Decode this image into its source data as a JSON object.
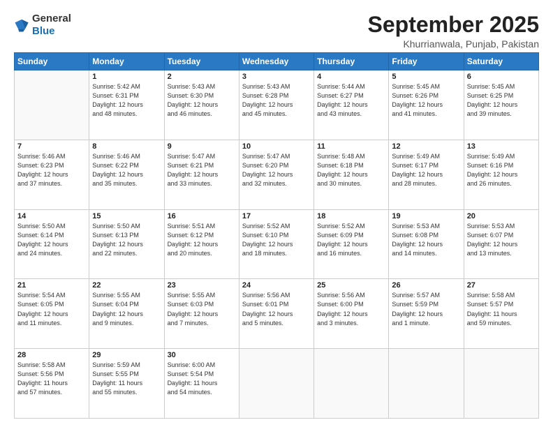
{
  "logo": {
    "general": "General",
    "blue": "Blue"
  },
  "header": {
    "month": "September 2025",
    "location": "Khurrianwala, Punjab, Pakistan"
  },
  "weekdays": [
    "Sunday",
    "Monday",
    "Tuesday",
    "Wednesday",
    "Thursday",
    "Friday",
    "Saturday"
  ],
  "weeks": [
    [
      {
        "day": "",
        "info": ""
      },
      {
        "day": "1",
        "info": "Sunrise: 5:42 AM\nSunset: 6:31 PM\nDaylight: 12 hours\nand 48 minutes."
      },
      {
        "day": "2",
        "info": "Sunrise: 5:43 AM\nSunset: 6:30 PM\nDaylight: 12 hours\nand 46 minutes."
      },
      {
        "day": "3",
        "info": "Sunrise: 5:43 AM\nSunset: 6:28 PM\nDaylight: 12 hours\nand 45 minutes."
      },
      {
        "day": "4",
        "info": "Sunrise: 5:44 AM\nSunset: 6:27 PM\nDaylight: 12 hours\nand 43 minutes."
      },
      {
        "day": "5",
        "info": "Sunrise: 5:45 AM\nSunset: 6:26 PM\nDaylight: 12 hours\nand 41 minutes."
      },
      {
        "day": "6",
        "info": "Sunrise: 5:45 AM\nSunset: 6:25 PM\nDaylight: 12 hours\nand 39 minutes."
      }
    ],
    [
      {
        "day": "7",
        "info": "Sunrise: 5:46 AM\nSunset: 6:23 PM\nDaylight: 12 hours\nand 37 minutes."
      },
      {
        "day": "8",
        "info": "Sunrise: 5:46 AM\nSunset: 6:22 PM\nDaylight: 12 hours\nand 35 minutes."
      },
      {
        "day": "9",
        "info": "Sunrise: 5:47 AM\nSunset: 6:21 PM\nDaylight: 12 hours\nand 33 minutes."
      },
      {
        "day": "10",
        "info": "Sunrise: 5:47 AM\nSunset: 6:20 PM\nDaylight: 12 hours\nand 32 minutes."
      },
      {
        "day": "11",
        "info": "Sunrise: 5:48 AM\nSunset: 6:18 PM\nDaylight: 12 hours\nand 30 minutes."
      },
      {
        "day": "12",
        "info": "Sunrise: 5:49 AM\nSunset: 6:17 PM\nDaylight: 12 hours\nand 28 minutes."
      },
      {
        "day": "13",
        "info": "Sunrise: 5:49 AM\nSunset: 6:16 PM\nDaylight: 12 hours\nand 26 minutes."
      }
    ],
    [
      {
        "day": "14",
        "info": "Sunrise: 5:50 AM\nSunset: 6:14 PM\nDaylight: 12 hours\nand 24 minutes."
      },
      {
        "day": "15",
        "info": "Sunrise: 5:50 AM\nSunset: 6:13 PM\nDaylight: 12 hours\nand 22 minutes."
      },
      {
        "day": "16",
        "info": "Sunrise: 5:51 AM\nSunset: 6:12 PM\nDaylight: 12 hours\nand 20 minutes."
      },
      {
        "day": "17",
        "info": "Sunrise: 5:52 AM\nSunset: 6:10 PM\nDaylight: 12 hours\nand 18 minutes."
      },
      {
        "day": "18",
        "info": "Sunrise: 5:52 AM\nSunset: 6:09 PM\nDaylight: 12 hours\nand 16 minutes."
      },
      {
        "day": "19",
        "info": "Sunrise: 5:53 AM\nSunset: 6:08 PM\nDaylight: 12 hours\nand 14 minutes."
      },
      {
        "day": "20",
        "info": "Sunrise: 5:53 AM\nSunset: 6:07 PM\nDaylight: 12 hours\nand 13 minutes."
      }
    ],
    [
      {
        "day": "21",
        "info": "Sunrise: 5:54 AM\nSunset: 6:05 PM\nDaylight: 12 hours\nand 11 minutes."
      },
      {
        "day": "22",
        "info": "Sunrise: 5:55 AM\nSunset: 6:04 PM\nDaylight: 12 hours\nand 9 minutes."
      },
      {
        "day": "23",
        "info": "Sunrise: 5:55 AM\nSunset: 6:03 PM\nDaylight: 12 hours\nand 7 minutes."
      },
      {
        "day": "24",
        "info": "Sunrise: 5:56 AM\nSunset: 6:01 PM\nDaylight: 12 hours\nand 5 minutes."
      },
      {
        "day": "25",
        "info": "Sunrise: 5:56 AM\nSunset: 6:00 PM\nDaylight: 12 hours\nand 3 minutes."
      },
      {
        "day": "26",
        "info": "Sunrise: 5:57 AM\nSunset: 5:59 PM\nDaylight: 12 hours\nand 1 minute."
      },
      {
        "day": "27",
        "info": "Sunrise: 5:58 AM\nSunset: 5:57 PM\nDaylight: 11 hours\nand 59 minutes."
      }
    ],
    [
      {
        "day": "28",
        "info": "Sunrise: 5:58 AM\nSunset: 5:56 PM\nDaylight: 11 hours\nand 57 minutes."
      },
      {
        "day": "29",
        "info": "Sunrise: 5:59 AM\nSunset: 5:55 PM\nDaylight: 11 hours\nand 55 minutes."
      },
      {
        "day": "30",
        "info": "Sunrise: 6:00 AM\nSunset: 5:54 PM\nDaylight: 11 hours\nand 54 minutes."
      },
      {
        "day": "",
        "info": ""
      },
      {
        "day": "",
        "info": ""
      },
      {
        "day": "",
        "info": ""
      },
      {
        "day": "",
        "info": ""
      }
    ]
  ]
}
